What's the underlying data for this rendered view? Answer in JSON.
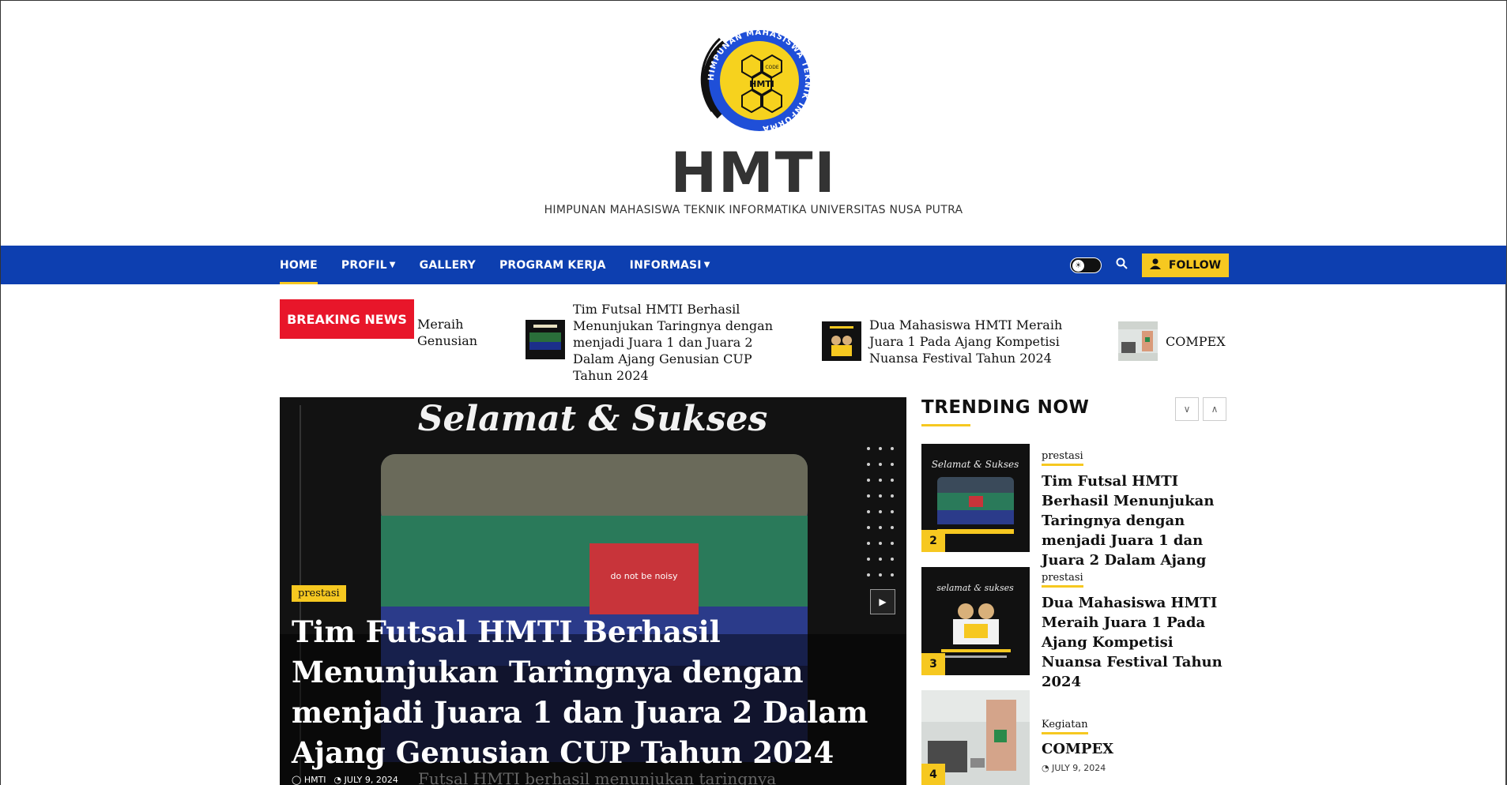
{
  "site": {
    "title": "HMTI",
    "tagline": "HIMPUNAN MAHASISWA TEKNIK INFORMATIKA UNIVERSITAS NUSA PUTRA",
    "logo_ring_text": "HIMPUNAN MAHASISWA TEKNIK INFORMATIKA",
    "logo_center": "HMTI",
    "logo_code": "CODE"
  },
  "nav": {
    "items": [
      {
        "label": "HOME",
        "active": true,
        "dropdown": false
      },
      {
        "label": "PROFIL",
        "active": false,
        "dropdown": true
      },
      {
        "label": "GALLERY",
        "active": false,
        "dropdown": false
      },
      {
        "label": "PROGRAM KERJA",
        "active": false,
        "dropdown": false
      },
      {
        "label": "INFORMASI",
        "active": false,
        "dropdown": true
      }
    ],
    "follow_label": "FOLLOW"
  },
  "breaking": {
    "label": "BREAKING NEWS",
    "partial": "Meraih Genusian",
    "items": [
      "Tim Futsal HMTI Berhasil Menunjukan Taringnya dengan menjadi Juara 1 dan Juara 2 Dalam Ajang Genusian CUP Tahun 2024",
      "Dua Mahasiswa HMTI Meraih Juara 1 Pada Ajang Kompetisi Nuansa Festival Tahun 2024",
      "COMPEX"
    ]
  },
  "hero": {
    "banner_text": "Selamat & Sukses",
    "banner_flag": "do not be noisy",
    "category": "prestasi",
    "title": "Tim Futsal HMTI Berhasil Menunjukan Taringnya dengan menjadi Juara 1 dan Juara 2 Dalam Ajang Genusian CUP Tahun 2024",
    "author": "HMTI",
    "date": "JULY 9, 2024",
    "excerpt": "Futsal HMTI berhasil menunjukan taringnya"
  },
  "trending": {
    "heading": "TRENDING NOW",
    "items": [
      {
        "num": "2",
        "category": "prestasi",
        "title": "Tim Futsal HMTI Berhasil Menunjukan Taringnya dengan menjadi Juara 1 dan Juara 2 Dalam Ajang",
        "thumb_text": "Selamat & Sukses"
      },
      {
        "num": "3",
        "category": "prestasi",
        "title": "Dua Mahasiswa HMTI Meraih Juara 1 Pada Ajang Kompetisi Nuansa Festival Tahun 2024",
        "thumb_text": "selamat & sukses"
      },
      {
        "num": "4",
        "category": "Kegiatan",
        "title": "COMPEX",
        "date": "JULY 9, 2024"
      }
    ]
  },
  "colors": {
    "nav_bg": "#0d3fb0",
    "accent": "#f6c820",
    "breaking": "#e8162a"
  }
}
